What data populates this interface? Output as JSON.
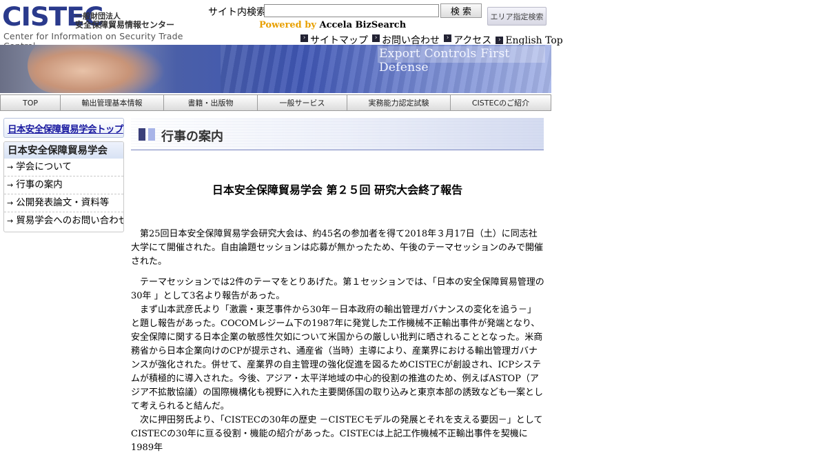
{
  "header": {
    "logo": {
      "wordmark": "CISTEC",
      "jp_line1": "一般財団法人",
      "jp_line2": "安全保障貿易情報センター",
      "en_line": "Center for Information on Security Trade Control"
    },
    "search": {
      "label": "サイト内検索",
      "value": "",
      "button_label": "検 索",
      "area_button_label": "エリア指定検索"
    },
    "powered_by": "Powered by",
    "powered_name": "Accela BizSearch",
    "top_links": [
      "サイトマップ",
      "お問い合わせ",
      "アクセス",
      "English Top"
    ]
  },
  "banner": {
    "tagline": "Export Controls First Defense"
  },
  "nav": {
    "items": [
      "TOP",
      "輸出管理基本情報",
      "書籍・出版物",
      "一般サービス",
      "実務能力認定試験",
      "CISTECのご紹介"
    ]
  },
  "sidebar": {
    "top_link": "日本安全保障貿易学会トップ",
    "menu_title": "日本安全保障貿易学会",
    "items": [
      "学会について",
      "行事の案内",
      "公開発表論文・資料等",
      "貿易学会へのお問い合わせ"
    ]
  },
  "main": {
    "section_title": "行事の案内",
    "report_title": "日本安全保障貿易学会 第２５回 研究大会終了報告",
    "paragraphs": [
      "　第25回日本安全保障貿易学会研究大会は、約45名の参加者を得て2018年３月17日（土）に同志社大学にて開催された。自由論題セッションは応募が無かったため、午後のテーマセッションのみで開催された。",
      "　テーマセッションでは2件のテーマをとりあげた。第１セッションでは、「日本の安全保障貿易管理の30年 」として3名より報告があった。",
      "　まず山本武彦氏より「激震・東芝事件から30年－日本政府の輸出管理ガバナンスの変化を追う－」と題し報告があった。COCOMレジーム下の1987年に発覚した工作機械不正輸出事件が発端となり、安全保障に関する日本企業の敏感性欠如について米国からの厳しい批判に晒されることとなった。米商務省から日本企業向けのCPが提示され、通産省（当時）主導により、産業界における輸出管理ガバナンスが強化された。併せて、産業界の自主管理の強化促進を図るためCISTECが創設され、ICPシステムが積極的に導入された。今後、アジア・太平洋地域の中心的役割の推進のため、例えばASTOP（アジア不拡散協議）の国際機構化も視野に入れた主要関係国の取り込みと東京本部の誘致なども一案として考えられると結んだ。",
      "　次に押田努氏より、「CISTECの30年の歴史 －CISTECモデルの発展とそれを支える要因－」として CISTECの30年に亘る役割・機能の紹介があった。CISTECは上記工作機械不正輸出事件を契機に1989年"
    ]
  }
}
